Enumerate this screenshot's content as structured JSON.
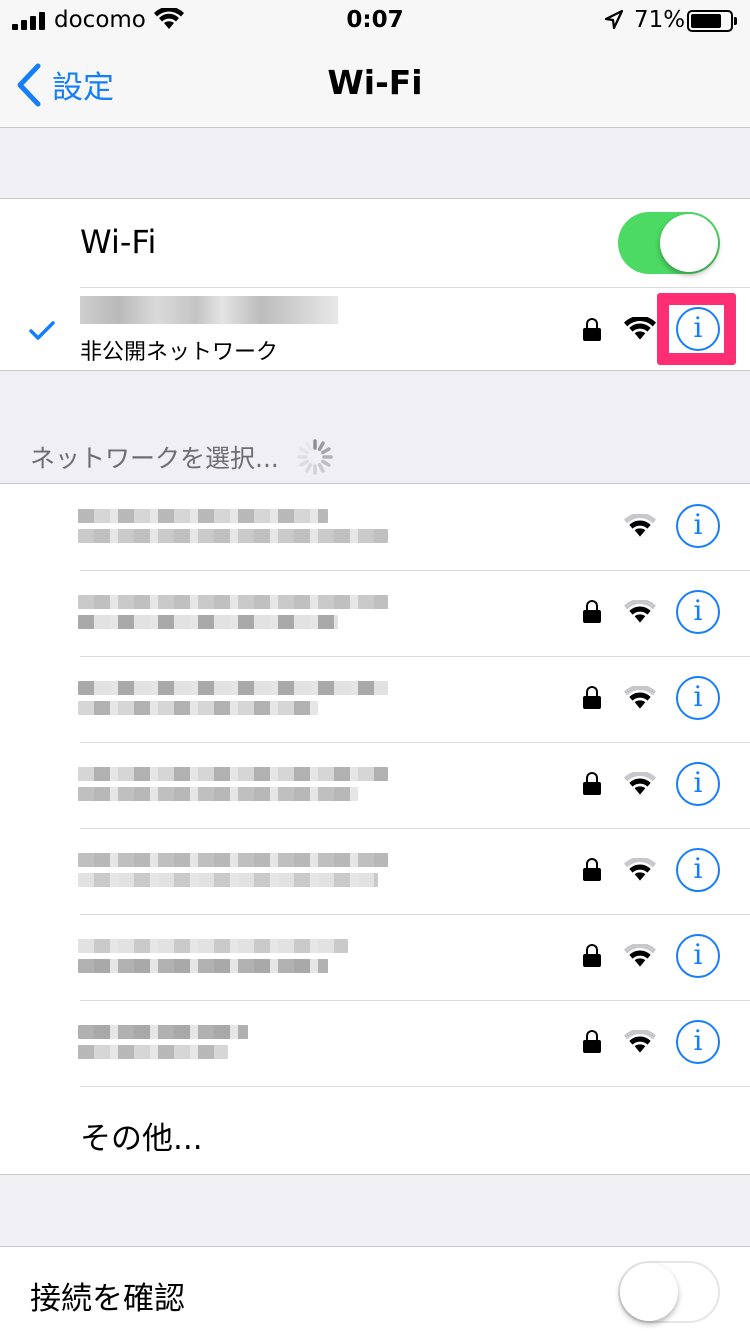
{
  "status_bar": {
    "carrier": "docomo",
    "time": "0:07",
    "battery_percent": "71%",
    "battery_level": 0.71
  },
  "nav": {
    "back_label": "設定",
    "title": "Wi-Fi"
  },
  "wifi_toggle": {
    "label": "Wi-Fi",
    "on": true
  },
  "connected_network": {
    "name_hidden": true,
    "subtitle": "非公開ネットワーク",
    "secured": true,
    "info_icon": "i"
  },
  "choose_network_header": "ネットワークを選択...",
  "networks": [
    {
      "secured": false,
      "info_icon": "i"
    },
    {
      "secured": true,
      "info_icon": "i"
    },
    {
      "secured": true,
      "info_icon": "i"
    },
    {
      "secured": true,
      "info_icon": "i"
    },
    {
      "secured": true,
      "info_icon": "i"
    },
    {
      "secured": true,
      "info_icon": "i"
    },
    {
      "secured": true,
      "info_icon": "i"
    }
  ],
  "other_label": "その他...",
  "ask_to_join": {
    "label": "接続を確認",
    "on": false
  },
  "colors": {
    "accent": "#157efb",
    "toggle_on": "#4cd964",
    "highlight": "#ff2d74"
  }
}
